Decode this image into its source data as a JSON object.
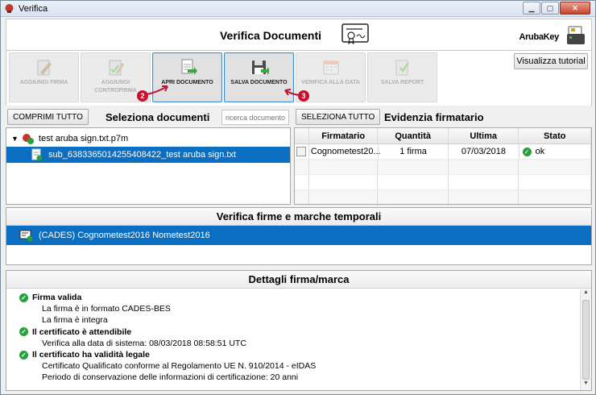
{
  "window": {
    "title": "Verifica"
  },
  "header": {
    "title": "Verifica Documenti",
    "brand": "ArubaKey"
  },
  "toolbar": {
    "buttons": [
      {
        "label": "AGGIUNGI FIRMA",
        "enabled": false
      },
      {
        "label": "AGGIUNGI CONTROFIRMA",
        "enabled": false
      },
      {
        "label": "APRI DOCUMENTO",
        "enabled": true
      },
      {
        "label": "SALVA DOCUMENTO",
        "enabled": true
      },
      {
        "label": "VERIFICA ALLA DATA",
        "enabled": false
      },
      {
        "label": "SALVA REPORT",
        "enabled": false
      }
    ],
    "tutorial_label": "Visualizza tutorial",
    "badges": [
      "2",
      "3"
    ]
  },
  "documents": {
    "collapse_label": "COMPRIMI TUTTO",
    "title": "Seleziona documenti",
    "search_placeholder": "ricerca documento",
    "tree": [
      {
        "label": "test aruba sign.txt.p7m"
      },
      {
        "label": "sub_6383365014255408422_test aruba sign.txt"
      }
    ]
  },
  "signer": {
    "select_all_label": "SELEZIONA TUTTO",
    "title": "Evidenzia firmatario",
    "columns": [
      "Firmatario",
      "Quantità",
      "Ultima",
      "Stato"
    ],
    "rows": [
      {
        "firmatario": "Cognometest20...",
        "quantita": "1 firma",
        "ultima": "07/03/2018",
        "stato": "ok"
      }
    ]
  },
  "signatures": {
    "title": "Verifica firme e marche temporali",
    "items": [
      {
        "label": "(CADES) Cognometest2016 Nometest2016"
      }
    ]
  },
  "details": {
    "title": "Dettagli firma/marca",
    "lines": [
      {
        "text": "Firma valida",
        "type": "head"
      },
      {
        "text": "La firma è in formato CADES-BES",
        "type": "sub"
      },
      {
        "text": "La firma è integra",
        "type": "sub"
      },
      {
        "text": "Il certificato è attendibile",
        "type": "head"
      },
      {
        "text": "Verifica alla data di sistema: 08/03/2018 08:58:51 UTC",
        "type": "sub"
      },
      {
        "text": "Il certificato ha validità legale",
        "type": "head"
      },
      {
        "text": "Certificato Qualificato conforme al Regolamento UE N. 910/2014 - eIDAS",
        "type": "sub"
      },
      {
        "text": "Periodo di conservazione delle informazioni di certificazione: 20 anni",
        "type": "sub"
      }
    ]
  },
  "colors": {
    "selection": "#0b6ec1",
    "accent_border": "#3c90d0",
    "ok_green": "#27a13a",
    "badge_red": "#c8102e"
  }
}
